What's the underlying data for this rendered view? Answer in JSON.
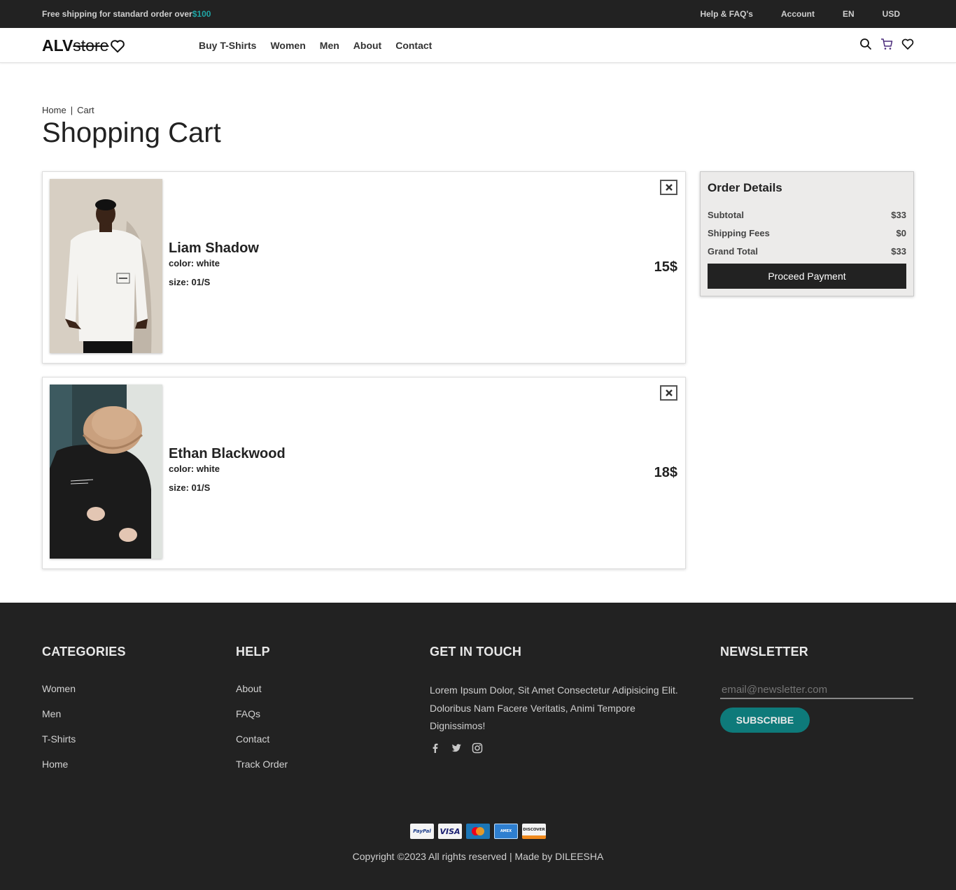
{
  "topbar": {
    "shipping_text": "Free shipping for standard order over",
    "shipping_amount": "$100",
    "links": [
      "Help & FAQ's",
      "Account",
      "EN",
      "USD"
    ]
  },
  "header": {
    "logo_bold": "ALV",
    "logo_struck": "store",
    "nav": [
      "Buy T-Shirts",
      "Women",
      "Men",
      "About",
      "Contact"
    ],
    "icons": [
      "search-icon",
      "cart-icon",
      "heart-icon"
    ]
  },
  "breadcrumb": {
    "home": "Home",
    "separator": "|",
    "current": "Cart"
  },
  "page_title": "Shopping Cart",
  "cart": {
    "items": [
      {
        "name": "Liam Shadow",
        "color": "color: white",
        "size": "size: 01/S",
        "price": "15$"
      },
      {
        "name": "Ethan Blackwood",
        "color": "color: white",
        "size": "size: 01/S",
        "price": "18$"
      }
    ]
  },
  "order": {
    "title": "Order Details",
    "rows": [
      {
        "label": "Subtotal",
        "value": "$33"
      },
      {
        "label": "Shipping Fees",
        "value": "$0"
      },
      {
        "label": "Grand Total",
        "value": "$33"
      }
    ],
    "button": "Proceed Payment"
  },
  "footer": {
    "categories": {
      "title": "CATEGORIES",
      "links": [
        "Women",
        "Men",
        "T-Shirts",
        "Home"
      ]
    },
    "help": {
      "title": "HELP",
      "links": [
        "About",
        "FAQs",
        "Contact",
        "Track Order"
      ]
    },
    "touch": {
      "title": "GET IN TOUCH",
      "text": "Lorem Ipsum Dolor, Sit Amet Consectetur Adipisicing Elit. Doloribus Nam Facere Veritatis, Animi Tempore Dignissimos!",
      "socials": [
        "facebook-icon",
        "twitter-icon",
        "instagram-icon"
      ]
    },
    "newsletter": {
      "title": "NEWSLETTER",
      "placeholder": "email@newsletter.com",
      "button": "SUBSCRIBE"
    },
    "payments": [
      "PayPal",
      "VISA",
      "MasterCard",
      "American Express",
      "DISCOVER"
    ],
    "copyright": "Copyright ©2023 All rights reserved | Made by DILEESHA"
  },
  "colors": {
    "accent": "#0e7a7a",
    "dark": "#222222",
    "order_bg": "#ecebea"
  }
}
